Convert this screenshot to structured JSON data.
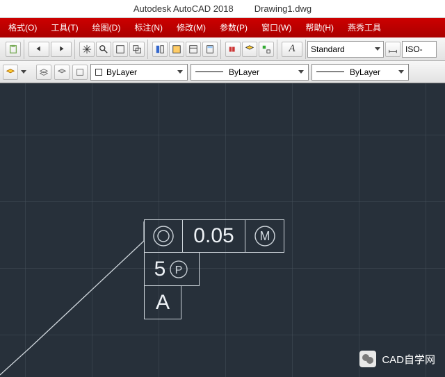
{
  "title": {
    "app": "Autodesk AutoCAD 2018",
    "file": "Drawing1.dwg"
  },
  "menu": {
    "format": "格式(O)",
    "tools": "工具(T)",
    "draw": "绘图(D)",
    "dim": "标注(N)",
    "modify": "修改(M)",
    "param": "参数(P)",
    "window": "窗口(W)",
    "help": "帮助(H)",
    "extra": "燕秀工具"
  },
  "toolbar1": {
    "textstyle": "Standard",
    "dimstyle": "ISO-"
  },
  "toolbar2": {
    "layer": "ByLayer",
    "linetype": "ByLayer",
    "lineweight": "ByLayer"
  },
  "drawing": {
    "gtol": {
      "symbol": "◎",
      "tolerance": "0.05",
      "material": "Ⓜ",
      "row2_val": "5",
      "row2_sym": "Ⓟ",
      "row3": "A"
    }
  },
  "watermark": "CAD自学网"
}
